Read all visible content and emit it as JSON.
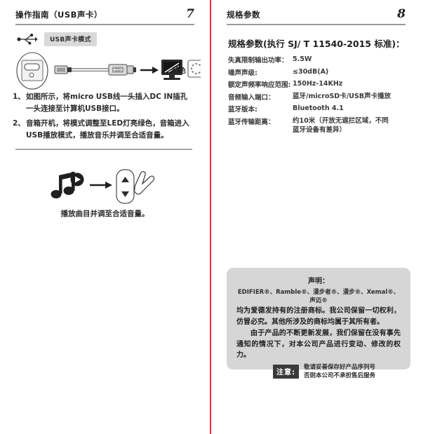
{
  "left_page": {
    "header": {
      "title": "操作指南（USB声卡）",
      "page_number": "7"
    },
    "mode": {
      "icon": "usb-icon",
      "badge_label": "USB声卡模式"
    },
    "diagram": {
      "icons": [
        "speaker-dc-in-port",
        "micro-usb-plug",
        "usb-cable",
        "usb-a-plug",
        "right-arrow",
        "computer-monitor",
        "led-indicator"
      ],
      "led_color_label": "绿色"
    },
    "steps": [
      {
        "number": "1、",
        "lines": [
          "如图所示，将micro USB线一头插入DC IN插孔",
          "一头连接至计算机USB接口。"
        ]
      },
      {
        "number": "2、",
        "lines": [
          "音箱开机，将模式调整至LED灯亮绿色，音箱进入",
          "USB播放模式，播放音乐并调至合适音量。"
        ]
      }
    ],
    "volume_section": {
      "icons": [
        "music-note-play-icon",
        "right-arrow",
        "volume-up-down-panel",
        "hand-pointer-icon"
      ],
      "caption": "播放曲目并调至合适音量。"
    }
  },
  "right_page": {
    "header": {
      "title": "规格参数",
      "page_number": "8"
    },
    "spec_title": "规格参数(执行 SJ/ T 11540-2015 标准)：",
    "specs": [
      {
        "key": "失真限制输出功率：",
        "value": "5.5W",
        "value2": ""
      },
      {
        "key": "噪声声级:",
        "value": "≤30dB(A)",
        "value2": ""
      },
      {
        "key": "额定声频率响应范围:",
        "value": "150Hz-14KHz",
        "value2": ""
      },
      {
        "key": "音频输入端口：",
        "value": "蓝牙/microSD卡/USB声卡播放",
        "value2": ""
      },
      {
        "key": "蓝牙版本:",
        "value": "Bluetooth 4.1",
        "value2": ""
      },
      {
        "key": "蓝牙传输距离：",
        "value": "约10米（开放无遮拦区域，不同",
        "value2": "蓝牙设备有差异）"
      }
    ],
    "declaration": {
      "title": "声明：",
      "trademarks": "EDIFIER®、Ramble®、漫步者®、漫步®、Xemal®、声迈®",
      "paragraph1": "均为爱德发持有的注册商标。我公司保留一切权利，仿冒必究。其他所涉及的商标均属于其所有者。",
      "paragraph2": "由于产品的不断更新发展，我们保留在没有事先通知的情况下，对本公司产品进行变动、修改的权力。"
    },
    "attention": {
      "tag": "注意:",
      "line1": "敬请妥善保存好产品序列号",
      "line2": "否则本公司不承担售后服务"
    }
  },
  "colors": {
    "gutter_red": "#ee2d32",
    "badge_gray": "#d9d9d9",
    "declaration_gray": "#d6d6d6",
    "ink": "#2b2b2b"
  }
}
